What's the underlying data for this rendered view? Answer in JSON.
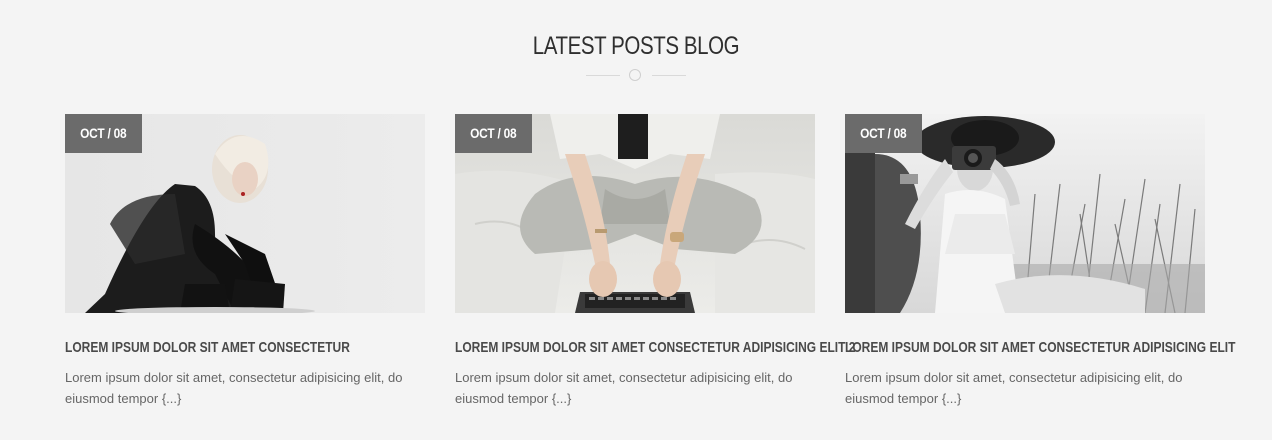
{
  "section": {
    "title": "LATEST POSTS BLOG"
  },
  "posts": [
    {
      "date": "OCT / 08",
      "title": "LOREM IPSUM DOLOR SIT AMET CONSECTETUR",
      "excerpt": "Lorem ipsum dolor sit amet, consectetur adipisicing elit, do eiusmod tempor {...}",
      "image": "woman-in-black-sitting-photo"
    },
    {
      "date": "OCT / 08",
      "title": "LOREM IPSUM DOLOR SIT AMET CONSECTETUR ADIPISICING ELIT 2",
      "excerpt": "Lorem ipsum dolor sit amet, consectetur adipisicing elit, do eiusmod tempor {...}",
      "image": "laptop-on-bed-photo"
    },
    {
      "date": "OCT / 08",
      "title": "LOREM IPSUM DOLOR SIT AMET CONSECTETUR ADIPISICING ELIT",
      "excerpt": "Lorem ipsum dolor sit amet, consectetur adipisicing elit, do eiusmod tempor {...}",
      "image": "woman-with-camera-in-grass-photo"
    }
  ],
  "colors": {
    "background": "#f4f4f4",
    "badge": "#6b6b6b",
    "title": "#2f2f2f",
    "post_title": "#4a4a4a",
    "text": "#666666"
  }
}
